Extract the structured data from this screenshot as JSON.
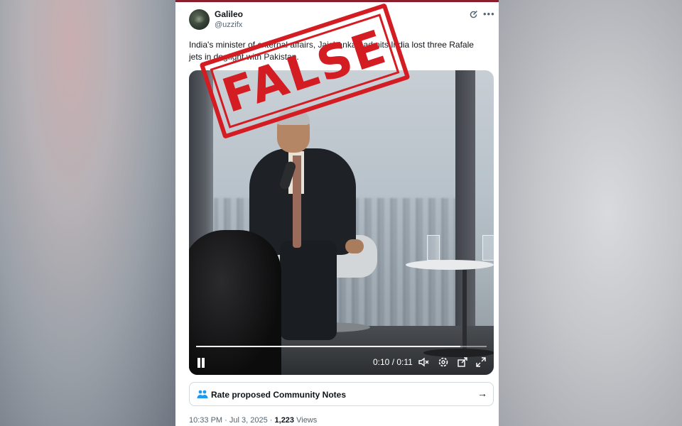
{
  "post": {
    "author_name": "Galileo",
    "author_handle": "@uzzifx",
    "text": "India's minister of external affairs, Jaishankar, admits India lost three Rafale jets in dogfight with Pakistan.",
    "stamp_text": "FALSE"
  },
  "video": {
    "time_display": "0:10 / 0:11",
    "progress_fraction": 0.91,
    "icons": [
      "pause-icon",
      "volume-icon",
      "settings-icon",
      "share-icon",
      "fullscreen-icon"
    ]
  },
  "community_notes": {
    "label": "Rate proposed Community Notes"
  },
  "footer": {
    "time": "10:33 PM",
    "separator": "·",
    "date": "Jul 3, 2025",
    "views_count": "1,223",
    "views_label": "Views"
  },
  "colors": {
    "stamp": "#d41c23",
    "community_notes_icon": "#1d9bf0",
    "text_primary": "#0f1419",
    "text_secondary": "#536471"
  }
}
